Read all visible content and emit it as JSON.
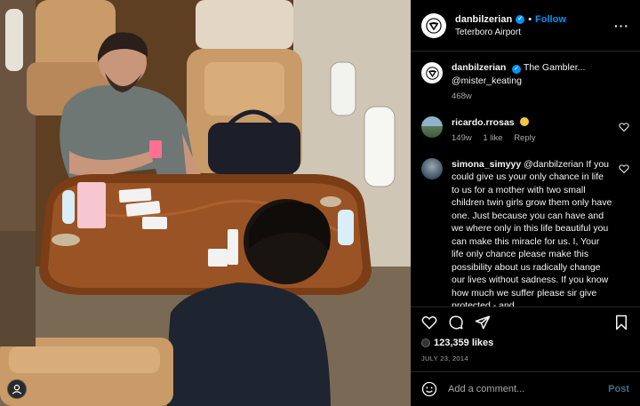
{
  "post": {
    "author": "danbilzerian",
    "follow_label": "Follow",
    "location": "Teterboro Airport",
    "caption_user": "danbilzerian",
    "caption_text": "The Gambler...",
    "caption_mention": "@mister_keating",
    "caption_age": "468w",
    "likes": "123,359 likes",
    "date": "JULY 23, 2014"
  },
  "comments": [
    {
      "user": "ricardo.rrosas",
      "text": "",
      "age": "149w",
      "likes": "1 like",
      "reply": "Reply"
    },
    {
      "user": "simona_simyyy",
      "text": "@danbilzerian If you could give us your only chance in life to us for a mother with two small children twin girls grow them only have one. Just because you can have and we where only in this life beautiful you can make this miracle for us. I, Your life only chance please make this possibility about us radically change our lives without sadness. If you know how much we suffer please sir give protected - and"
    }
  ],
  "composer": {
    "placeholder": "Add a comment...",
    "post_label": "Post"
  },
  "icons": [
    "logo-icon",
    "verified-icon",
    "more-icon",
    "heart-icon",
    "comment-icon",
    "share-icon",
    "bookmark-icon",
    "smile-icon",
    "profile-icon"
  ],
  "colors": {
    "accent": "#0095f6",
    "background": "#000000",
    "muted": "#a8a8a8"
  }
}
